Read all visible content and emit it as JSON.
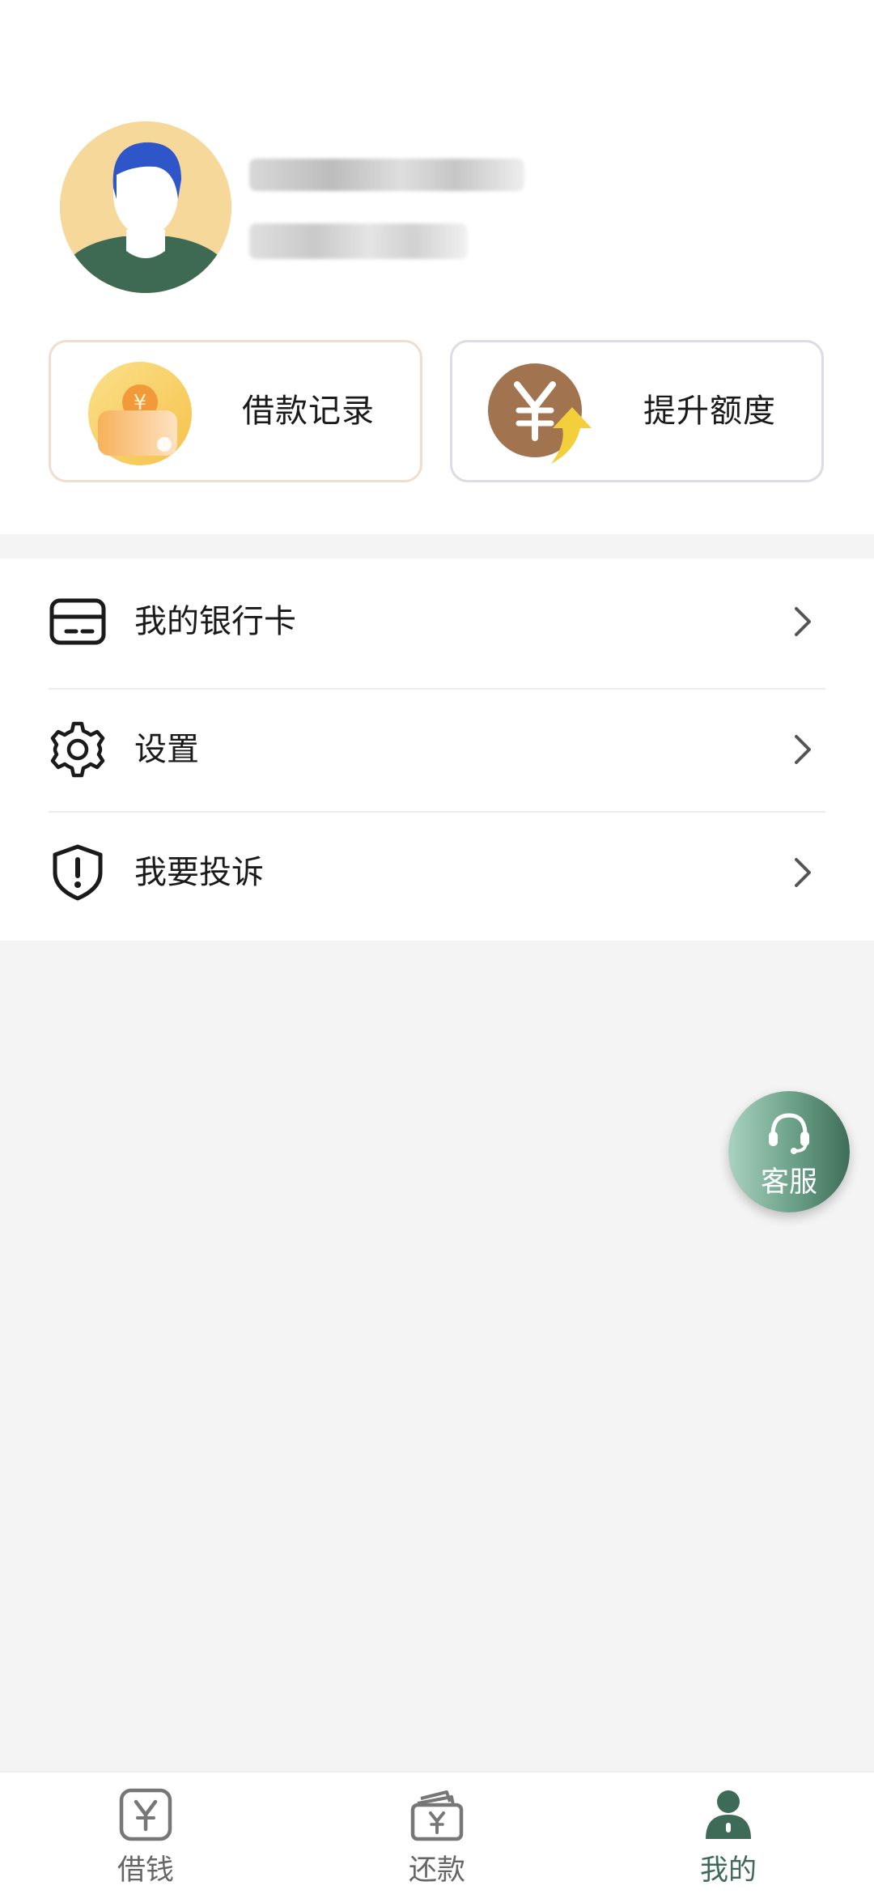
{
  "profile": {
    "name": "",
    "phone": ""
  },
  "cards": {
    "loan_records": "借款记录",
    "raise_limit": "提升额度"
  },
  "menu": {
    "items": [
      {
        "label": "我的银行卡",
        "icon": "bank-card-icon"
      },
      {
        "label": "设置",
        "icon": "gear-icon"
      },
      {
        "label": "我要投诉",
        "icon": "shield-alert-icon"
      }
    ]
  },
  "customer_service": {
    "label": "客服",
    "icon": "headset-icon"
  },
  "tabbar": {
    "tabs": [
      {
        "label": "借钱",
        "icon": "yen-box-icon",
        "active": false
      },
      {
        "label": "还款",
        "icon": "repay-wallet-icon",
        "active": false
      },
      {
        "label": "我的",
        "icon": "user-icon",
        "active": true
      }
    ]
  },
  "colors": {
    "accent": "#3d6b58",
    "page_background": "#f4f4f4",
    "loan_card_border": "#f1ddd0",
    "limit_card_border": "#dcdce6"
  }
}
